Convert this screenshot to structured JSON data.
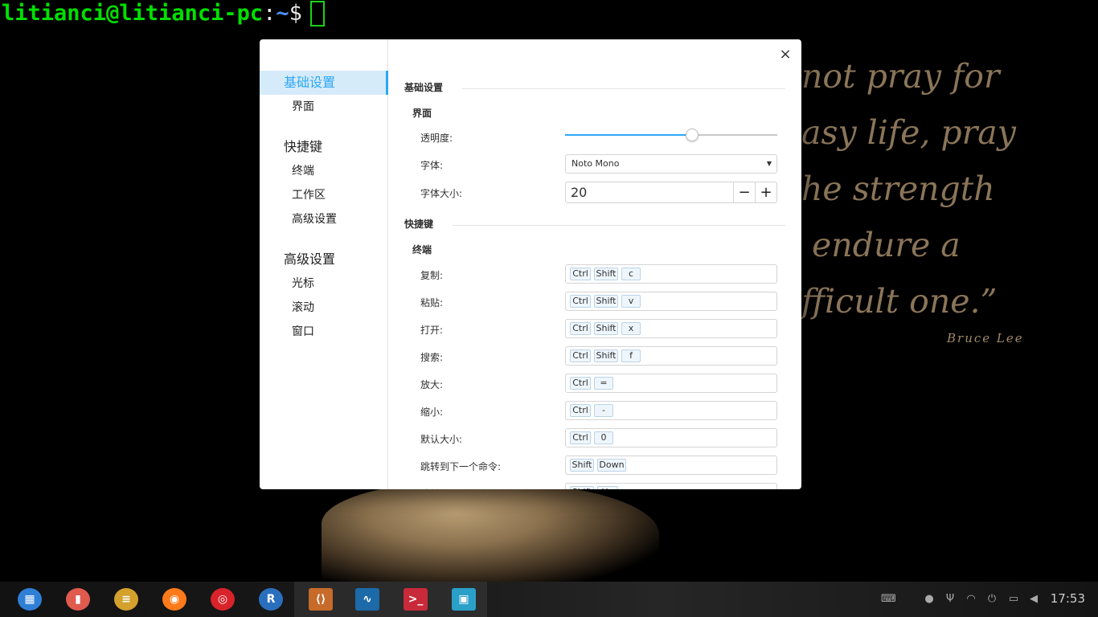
{
  "terminal": {
    "user_host": "litianci@litianci-pc",
    "colon": ":",
    "path": "~",
    "dollar": "$"
  },
  "wallpaper": {
    "quote_lines": "not pray for\nasy life, pray\nhe strength\n endure a\nfficult one.”",
    "author": "Bruce Lee"
  },
  "sidebar": {
    "items": [
      {
        "label": "基础设置",
        "type": "group",
        "active": true
      },
      {
        "label": "界面",
        "type": "sub"
      },
      {
        "label": "快捷键",
        "type": "group"
      },
      {
        "label": "终端",
        "type": "sub"
      },
      {
        "label": "工作区",
        "type": "sub"
      },
      {
        "label": "高级设置",
        "type": "sub"
      },
      {
        "label": "高级设置",
        "type": "group"
      },
      {
        "label": "光标",
        "type": "sub"
      },
      {
        "label": "滚动",
        "type": "sub"
      },
      {
        "label": "窗口",
        "type": "sub"
      }
    ]
  },
  "dialog": {
    "close_icon": "×",
    "basic_section": "基础设置",
    "interface_sub": "界面",
    "opacity_label": "透明度:",
    "opacity_value": 0.6,
    "font_label": "字体:",
    "font_value": "Noto Mono",
    "font_size_label": "字体大小:",
    "font_size_value": "20",
    "minus": "−",
    "plus": "+",
    "shortcut_section": "快捷键",
    "terminal_sub": "终端",
    "shortcuts": [
      {
        "label": "复制:",
        "keys": [
          "Ctrl",
          "Shift",
          "c"
        ]
      },
      {
        "label": "粘贴:",
        "keys": [
          "Ctrl",
          "Shift",
          "v"
        ]
      },
      {
        "label": "打开:",
        "keys": [
          "Ctrl",
          "Shift",
          "x"
        ]
      },
      {
        "label": "搜索:",
        "keys": [
          "Ctrl",
          "Shift",
          "f"
        ]
      },
      {
        "label": "放大:",
        "keys": [
          "Ctrl",
          "="
        ]
      },
      {
        "label": "缩小:",
        "keys": [
          "Ctrl",
          "-"
        ]
      },
      {
        "label": "默认大小:",
        "keys": [
          "Ctrl",
          "0"
        ]
      },
      {
        "label": "跳转到下一个命令:",
        "keys": [
          "Shift",
          "Down"
        ]
      },
      {
        "label": "跳转到上一个命令:",
        "keys": [
          "Shift",
          "Up"
        ]
      }
    ]
  },
  "dock": {
    "apps": [
      {
        "name": "launcher-icon",
        "color": "#2f7fd6",
        "glyph": "▦"
      },
      {
        "name": "screen-recorder-icon",
        "color": "#e05a4e",
        "glyph": "▮"
      },
      {
        "name": "archive-manager-icon",
        "color": "#d4a12c",
        "glyph": "≡"
      },
      {
        "name": "firefox-icon",
        "color": "#ff7a1a",
        "glyph": "◉"
      },
      {
        "name": "netease-music-icon",
        "color": "#d8232a",
        "glyph": "◎"
      },
      {
        "name": "r-studio-icon",
        "color": "#2a6fbe",
        "glyph": "R"
      },
      {
        "name": "vscode-icon",
        "color": "#c76b2b",
        "glyph": "⟨⟩"
      },
      {
        "name": "system-monitor-icon",
        "color": "#1c6aa8",
        "glyph": "∿"
      },
      {
        "name": "terminal-icon",
        "color": "#c92a3a",
        "glyph": ">_"
      },
      {
        "name": "file-manager-icon",
        "color": "#2aa0c9",
        "glyph": "▣"
      }
    ],
    "tray": [
      {
        "name": "keyboard-icon",
        "glyph": "⌨"
      },
      {
        "name": "notification-icon",
        "glyph": "●"
      },
      {
        "name": "usb-icon",
        "glyph": "Ψ"
      },
      {
        "name": "wifi-icon",
        "glyph": "◠"
      },
      {
        "name": "power-icon",
        "glyph": "⏻"
      },
      {
        "name": "battery-icon",
        "glyph": "▭"
      },
      {
        "name": "volume-icon",
        "glyph": "◀"
      }
    ],
    "clock": "17:53"
  }
}
